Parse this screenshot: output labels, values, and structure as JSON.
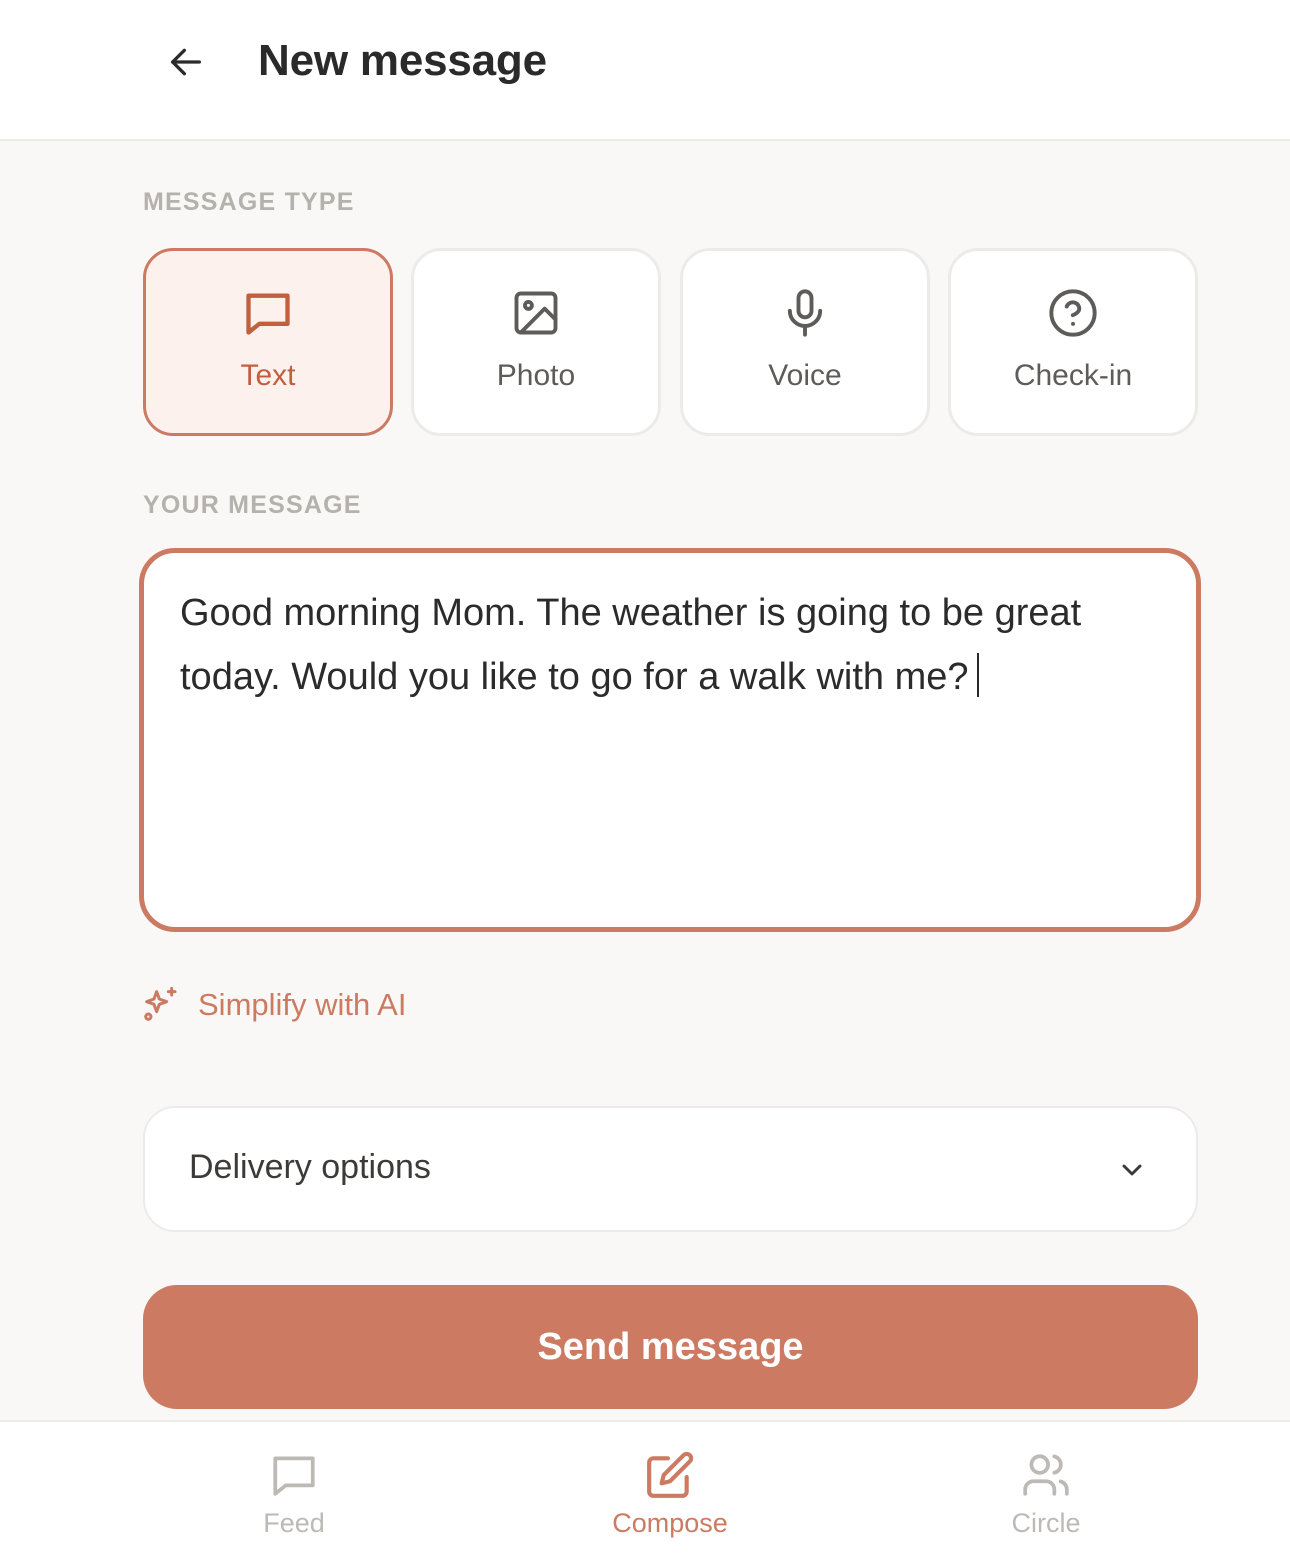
{
  "header": {
    "title": "New message",
    "back_icon": "arrow-left-icon"
  },
  "message_type": {
    "label": "MESSAGE TYPE",
    "options": [
      {
        "label": "Text",
        "icon": "message-square-icon",
        "selected": true
      },
      {
        "label": "Photo",
        "icon": "image-icon",
        "selected": false
      },
      {
        "label": "Voice",
        "icon": "microphone-icon",
        "selected": false
      },
      {
        "label": "Check-in",
        "icon": "help-circle-icon",
        "selected": false
      }
    ]
  },
  "your_message": {
    "label": "YOUR MESSAGE",
    "value": "Good morning Mom. The weather is going to be great today. Would you like to go for a walk with me?"
  },
  "simplify": {
    "label": "Simplify with AI",
    "icon": "sparkles-icon"
  },
  "delivery": {
    "label": "Delivery options",
    "icon": "chevron-down-icon"
  },
  "send": {
    "label": "Send message"
  },
  "tabbar": {
    "items": [
      {
        "label": "Feed",
        "icon": "message-square-icon",
        "active": false
      },
      {
        "label": "Compose",
        "icon": "edit-icon",
        "active": true
      },
      {
        "label": "Circle",
        "icon": "users-icon",
        "active": false
      }
    ]
  },
  "colors": {
    "accent": "#cc7b62",
    "accent_text": "#c1603f",
    "selected_bg": "#fdf1ee",
    "background": "#f9f8f6",
    "border": "#ecebe8",
    "muted": "#bdbab5"
  }
}
